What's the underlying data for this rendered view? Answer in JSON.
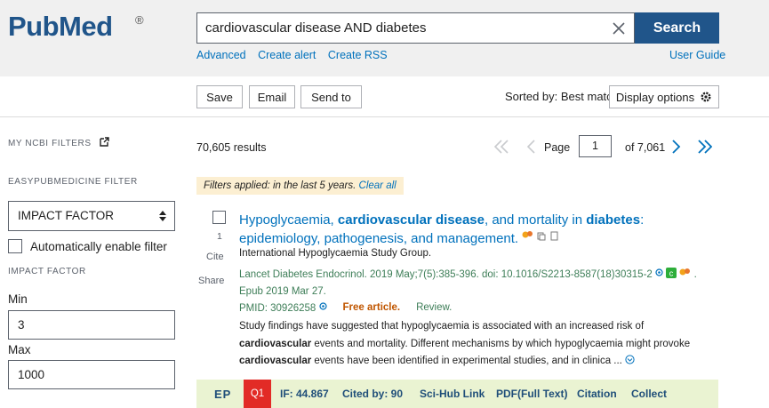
{
  "header": {
    "logo_text": "PubMed",
    "logo_reg": "®",
    "search_value": "cardiovascular disease AND diabetes",
    "search_button": "Search",
    "links": [
      "Advanced",
      "Create alert",
      "Create RSS"
    ],
    "user_guide": "User Guide"
  },
  "toolbar": {
    "save": "Save",
    "email": "Email",
    "send_to": "Send to",
    "sorted_by": "Sorted by: Best match",
    "display_options": "Display options"
  },
  "sidebar": {
    "my_ncbi_filters": "MY NCBI FILTERS",
    "easypubmedicine_filter": "EASYPUBMEDICINE FILTER",
    "impact_factor_select": "IMPACT FACTOR",
    "auto_enable": "Automatically enable filter",
    "impact_factor_label": "IMPACT FACTOR",
    "min_label": "Min",
    "min_value": "3",
    "max_label": "Max",
    "max_value": "1000"
  },
  "results": {
    "count": "70,605 results",
    "page_label": "Page",
    "page_value": "1",
    "of_pages": "of 7,061",
    "filters_text": "Filters applied: in the last 5 years.",
    "clear_all": "Clear all"
  },
  "article": {
    "number": "1",
    "cite": "Cite",
    "share": "Share",
    "title_parts": [
      "Hypoglycaemia, ",
      "cardiovascular disease",
      ", and mortality in ",
      "diabetes",
      ": epidemiology, pathogenesis, and management."
    ],
    "authors": "International Hypoglycaemia Study Group.",
    "journal": "Lancet Diabetes Endocrinol. 2019 May;7(5):385-396. doi: ",
    "doi": "10.1016/S2213-8587(18)30315-2",
    "epub": ". Epub 2019 Mar 27.",
    "pmid": "PMID: 30926258",
    "free": "Free article.",
    "review": "Review.",
    "snippet_parts": [
      "Study findings have suggested that hypoglycaemia is associated with an increased risk of ",
      "cardiovascular",
      " events and mortality. Different mechanisms by which hypoglycaemia might provoke ",
      "cardiovascular",
      " events have been identified in experimental studies, and in clinica ..."
    ]
  },
  "ep_bar": {
    "logo": "EP",
    "quartile": "Q1",
    "impact_factor": "IF: 44.867",
    "cited_by": "Cited by:  90",
    "scihub": "Sci-Hub Link",
    "pdf": "PDF(Full Text)",
    "citation": "Citation",
    "collect": "Collect"
  },
  "colors": {
    "brand": "#20558a",
    "link": "#0071bc",
    "green_meta": "#3e7e58",
    "free_article": "#c05600",
    "filter_bg": "#fcefd2",
    "ep_bar_bg": "#eaf3d2",
    "q1_badge": "#e22b26"
  },
  "icons": [
    "clear-x-icon",
    "gear-icon",
    "external-link-icon",
    "select-arrows-icon",
    "first-page-icon",
    "prev-page-icon",
    "next-page-icon",
    "last-page-icon",
    "expand-snippet-icon"
  ]
}
